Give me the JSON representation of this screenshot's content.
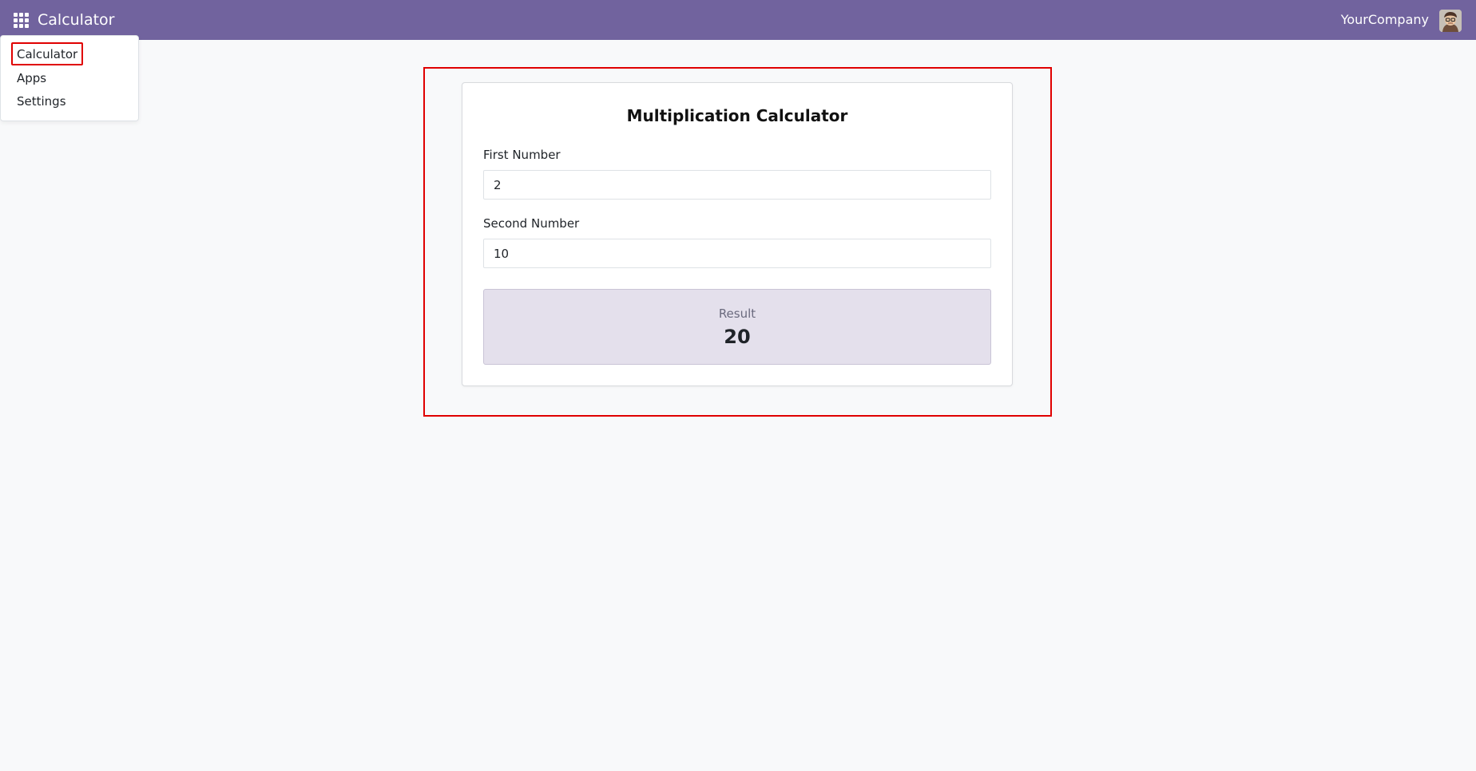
{
  "navbar": {
    "brand": "Calculator",
    "company": "YourCompany",
    "apps_icon": "grid-icon",
    "avatar_icon": "user-avatar"
  },
  "menu": {
    "items": [
      {
        "label": "Calculator"
      },
      {
        "label": "Apps"
      },
      {
        "label": "Settings"
      }
    ]
  },
  "calculator": {
    "title": "Multiplication Calculator",
    "first_label": "First Number",
    "first_value": "2",
    "second_label": "Second Number",
    "second_value": "10",
    "result_label": "Result",
    "result_value": "20"
  },
  "colors": {
    "navbar": "#71639e",
    "result_background": "#e4e0ec",
    "highlight": "#e00000"
  }
}
